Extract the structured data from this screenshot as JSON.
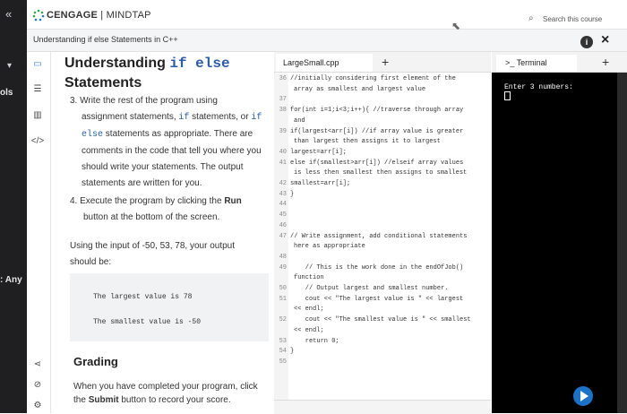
{
  "nav": {
    "back": "«"
  },
  "brand": {
    "name": "CENGAGE",
    "product": "MINDTAP"
  },
  "search": {
    "label": "Search this course"
  },
  "breadcrumb": "Understanding if else Statements in C++",
  "header_buttons": {
    "info": "i",
    "close": "×"
  },
  "left_strip": {
    "top_label": "ols",
    "bottom_label": ": Any"
  },
  "lesson": {
    "title_prefix": "Understanding ",
    "title_code": "if else",
    "title_suffix": "Statements",
    "step3_intro": "3. Write the rest of the program using",
    "step3_parts": [
      "assignment statements, ",
      "if",
      " statements, or ",
      "if else",
      " statements as appropriate. There are comments in the code that tell you where you should write your statements. The output statements are written for you."
    ],
    "step4_intro": "4. Execute the program by clicking the ",
    "step4_bold": "Run",
    "step4_rest": "button at the bottom of the screen.",
    "input_note": "Using the input of -50, 53, 78, your output should be:",
    "expected_output": [
      "The largest value is 78",
      "The smallest value is -50"
    ],
    "grading_title": "Grading",
    "grading_text_pre": "When you have completed your program, click the ",
    "grading_text_bold": "Submit",
    "grading_text_post": " button to record your score."
  },
  "editor": {
    "file_tab": "LargeSmall.cpp",
    "add": "+",
    "lines": [
      {
        "n": "36",
        "t": "//initially considering first element of the"
      },
      {
        "n": "",
        "t": "array as smallest and largest value"
      },
      {
        "n": "37",
        "t": ""
      },
      {
        "n": "38",
        "t": "for(int i=1;i<3;i++){ //traverse through array"
      },
      {
        "n": "",
        "t": "and"
      },
      {
        "n": "39",
        "t": "if(largest<arr[i]) //if array value is greater"
      },
      {
        "n": "",
        "t": "than largest then assigns it to largest"
      },
      {
        "n": "40",
        "t": "largest=arr[i];"
      },
      {
        "n": "41",
        "t": "else if(smallest>arr[i]) //elseif array values"
      },
      {
        "n": "",
        "t": "is less then smallest then assigns to smallest"
      },
      {
        "n": "42",
        "t": "smallest=arr[i];"
      },
      {
        "n": "43",
        "t": "}"
      },
      {
        "n": "44",
        "t": ""
      },
      {
        "n": "45",
        "t": ""
      },
      {
        "n": "46",
        "t": ""
      },
      {
        "n": "47",
        "t": "// Write assignment, add conditional statements"
      },
      {
        "n": "",
        "t": "here as appropriate"
      },
      {
        "n": "48",
        "t": ""
      },
      {
        "n": "49",
        "t": "    // This is the work done in the endOfJob()"
      },
      {
        "n": "",
        "t": "function"
      },
      {
        "n": "50",
        "t": "    // Output largest and smallest number."
      },
      {
        "n": "51",
        "t": "    cout << \"The largest value is \" << largest"
      },
      {
        "n": "",
        "t": "<< endl;"
      },
      {
        "n": "52",
        "t": "    cout << \"The smallest value is \" << smallest"
      },
      {
        "n": "",
        "t": "<< endl;"
      },
      {
        "n": "53",
        "t": "    return 0;"
      },
      {
        "n": "54",
        "t": "}"
      },
      {
        "n": "55",
        "t": ""
      }
    ]
  },
  "terminal": {
    "tab": "Terminal",
    "prompt_icon": ">_",
    "add": "+",
    "output": "Enter 3 numbers:"
  }
}
